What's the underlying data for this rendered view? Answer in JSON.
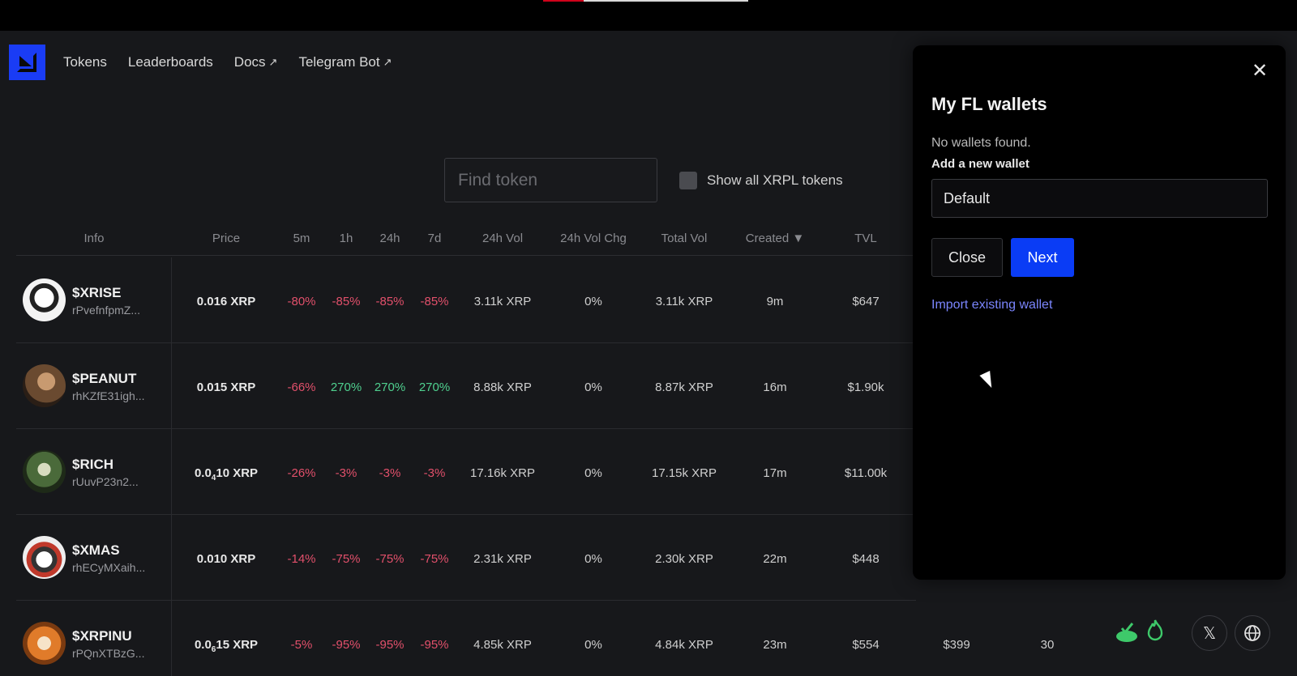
{
  "nav": {
    "items": [
      {
        "label": "Tokens",
        "external": false
      },
      {
        "label": "Leaderboards",
        "external": false
      },
      {
        "label": "Docs",
        "external": true
      },
      {
        "label": "Telegram Bot",
        "external": true
      }
    ],
    "external_glyph": "↗"
  },
  "search": {
    "placeholder": "Find token"
  },
  "show_all": {
    "label": "Show all XRPL tokens",
    "checked": false
  },
  "table": {
    "headers": {
      "info": "Info",
      "price": "Price",
      "m5": "5m",
      "h1": "1h",
      "h24": "24h",
      "d7": "7d",
      "vol24": "24h Vol",
      "volchg": "24h Vol Chg",
      "totalvol": "Total Vol",
      "created": "Created ▼",
      "tvl": "TVL"
    },
    "rows": [
      {
        "symbol": "$XRISE",
        "addr": "rPvefnfpmZ...",
        "price_main": "0.016 XRP",
        "price_sub": "",
        "price_rest": "",
        "m5": "-80%",
        "h1": "-85%",
        "h24": "-85%",
        "d7": "-85%",
        "vol24": "3.11k XRP",
        "volchg": "0%",
        "totalvol": "3.11k XRP",
        "created": "9m",
        "tvl": "$647"
      },
      {
        "symbol": "$PEANUT",
        "addr": "rhKZfE31igh...",
        "price_main": "0.015 XRP",
        "price_sub": "",
        "price_rest": "",
        "m5": "-66%",
        "h1": "270%",
        "h24": "270%",
        "d7": "270%",
        "vol24": "8.88k XRP",
        "volchg": "0%",
        "totalvol": "8.87k XRP",
        "created": "16m",
        "tvl": "$1.90k"
      },
      {
        "symbol": "$RICH",
        "addr": "rUuvP23n2...",
        "price_main": "0.0",
        "price_sub": "4",
        "price_rest": "10 XRP",
        "m5": "-26%",
        "h1": "-3%",
        "h24": "-3%",
        "d7": "-3%",
        "vol24": "17.16k XRP",
        "volchg": "0%",
        "totalvol": "17.15k XRP",
        "created": "17m",
        "tvl": "$11.00k"
      },
      {
        "symbol": "$XMAS",
        "addr": "rhECyMXaih...",
        "price_main": "0.010 XRP",
        "price_sub": "",
        "price_rest": "",
        "m5": "-14%",
        "h1": "-75%",
        "h24": "-75%",
        "d7": "-75%",
        "vol24": "2.31k XRP",
        "volchg": "0%",
        "totalvol": "2.30k XRP",
        "created": "22m",
        "tvl": "$448"
      },
      {
        "symbol": "$XRPINU",
        "addr": "rPQnXTBzG...",
        "price_main": "0.0",
        "price_sub": "6",
        "price_rest": "15 XRP",
        "m5": "-5%",
        "h1": "-95%",
        "h24": "-95%",
        "d7": "-95%",
        "vol24": "4.85k XRP",
        "volchg": "0%",
        "totalvol": "4.84k XRP",
        "created": "23m",
        "tvl": "$554",
        "extra1": "$399",
        "extra2": "30"
      }
    ]
  },
  "modal": {
    "title": "My FL wallets",
    "message": "No wallets found.",
    "add_label": "Add a new wallet",
    "input_value": "Default",
    "close_label": "Close",
    "next_label": "Next",
    "import_link": "Import existing wallet",
    "close_glyph": "✕"
  },
  "colors": {
    "accent": "#0a3cf5",
    "negative": "#e2506b",
    "positive": "#4fd08f",
    "link": "#7b86ff"
  }
}
